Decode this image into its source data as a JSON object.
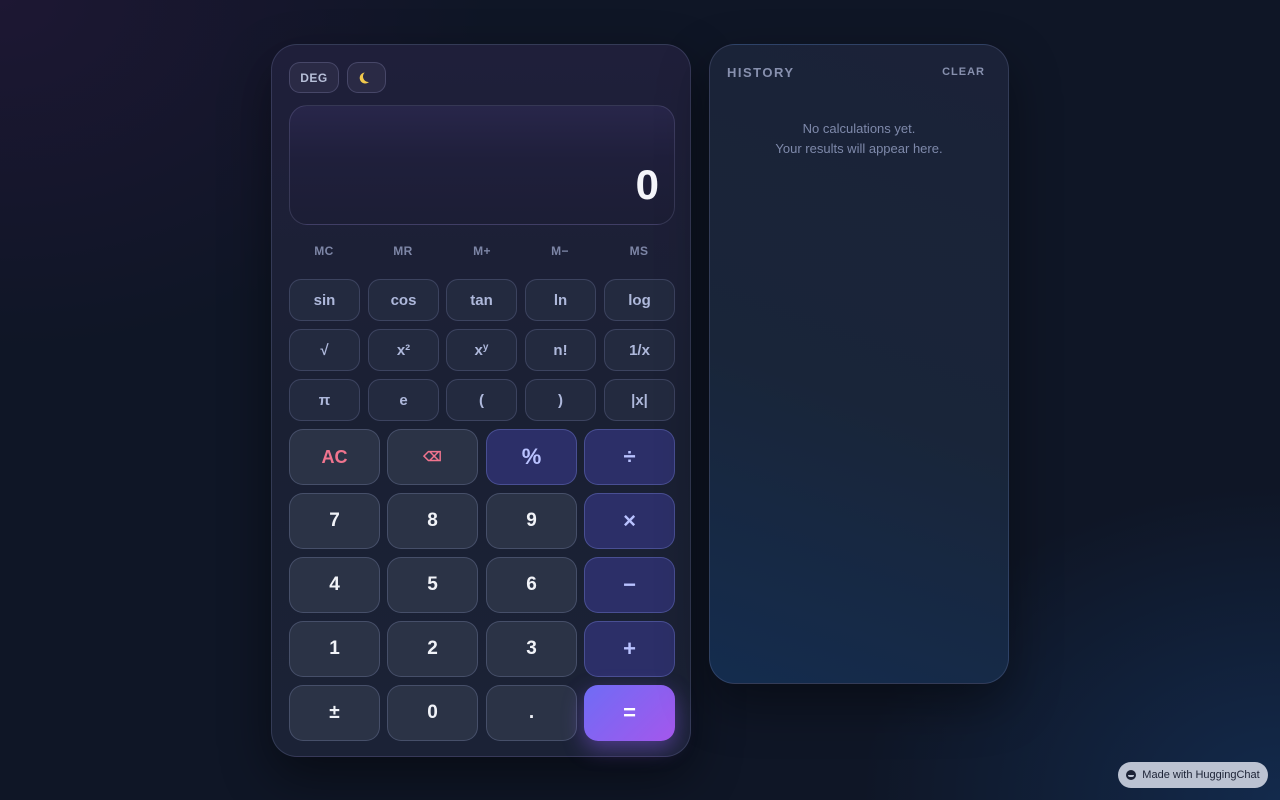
{
  "calculator": {
    "mode_label": "DEG",
    "theme_icon": "moon-icon",
    "display_value": "0",
    "memory": [
      "MC",
      "MR",
      "M+",
      "M−",
      "MS"
    ],
    "scientific": {
      "sin": "sin",
      "cos": "cos",
      "tan": "tan",
      "ln": "ln",
      "log": "log",
      "sqrt": "√",
      "square_base": "x",
      "square_exp": "²",
      "power_base": "x",
      "power_exp": "y",
      "factorial": "n!",
      "reciprocal": "1/x",
      "pi": "π",
      "e": "e",
      "open_paren": "(",
      "close_paren": ")",
      "abs": "|x|"
    },
    "keys": {
      "all_clear": "AC",
      "backspace": "⌫",
      "percent": "%",
      "divide": "÷",
      "seven": "7",
      "eight": "8",
      "nine": "9",
      "multiply": "×",
      "four": "4",
      "five": "5",
      "six": "6",
      "subtract": "−",
      "one": "1",
      "two": "2",
      "three": "3",
      "add": "+",
      "sign": "±",
      "zero": "0",
      "decimal": ".",
      "equals": "="
    },
    "colors": {
      "operator": "#2c2f68",
      "clear_accent": "#f0748e",
      "equals_gradient_start": "#6f6cf5",
      "equals_gradient_end": "#a457ec"
    }
  },
  "history": {
    "title": "HISTORY",
    "clear_label": "CLEAR",
    "empty_line1": "No calculations yet.",
    "empty_line2": "Your results will appear here."
  },
  "badge": {
    "icon": "huggingface-icon",
    "label": "Made with HuggingChat"
  }
}
